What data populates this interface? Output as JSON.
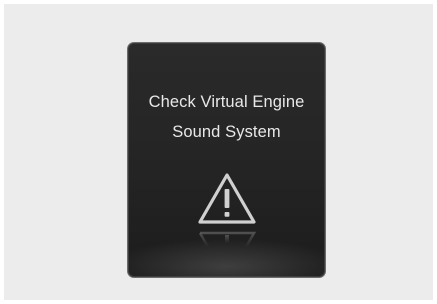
{
  "warning": {
    "line1": "Check Virtual Engine",
    "line2": "Sound System",
    "icon": "warning-triangle-icon"
  },
  "colors": {
    "display_background": "#242424",
    "text": "#e8e8e8",
    "icon_stroke": "#d0d0d0",
    "page_background": "#ececec"
  }
}
